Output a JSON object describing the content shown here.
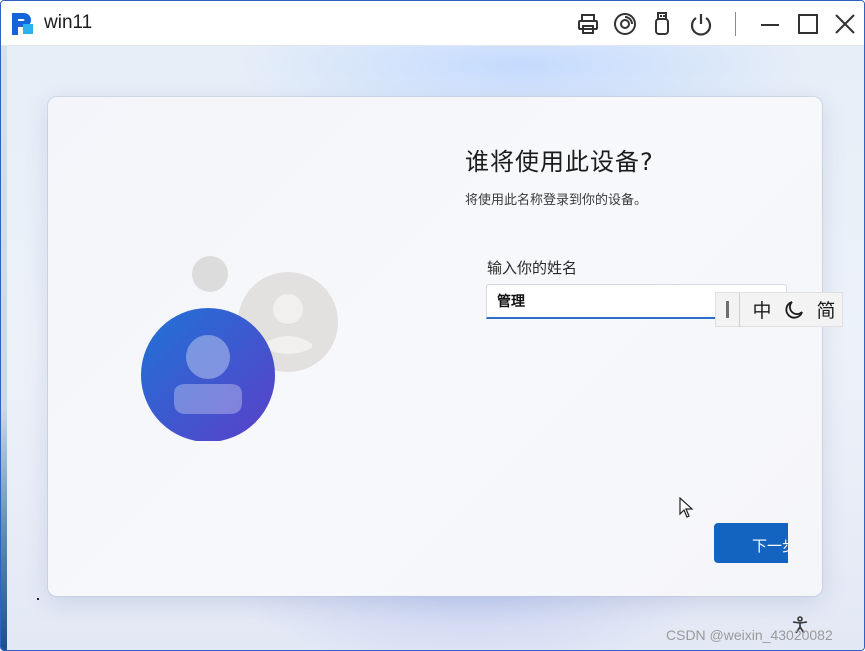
{
  "window": {
    "title": "win11",
    "toolbar_icons": [
      "printer-icon",
      "disc-icon",
      "usb-icon",
      "power-icon",
      "minimize-icon",
      "maximize-icon",
      "close-icon"
    ]
  },
  "oobe": {
    "heading": "谁将使用此设备?",
    "subtext": "将使用此名称登录到你的设备。",
    "name_label": "输入你的姓名",
    "name_value": "管理",
    "next_label": "下一步"
  },
  "ime": {
    "mode": "中",
    "punctuation_icon": "moon-icon",
    "script": "简"
  },
  "watermark": "CSDN @weixin_43020082",
  "colors": {
    "accent": "#1264c0",
    "input_underline": "#2c6fc4",
    "avatar_gradient_start": "#1f73d6",
    "avatar_gradient_end": "#5b3fc9"
  }
}
